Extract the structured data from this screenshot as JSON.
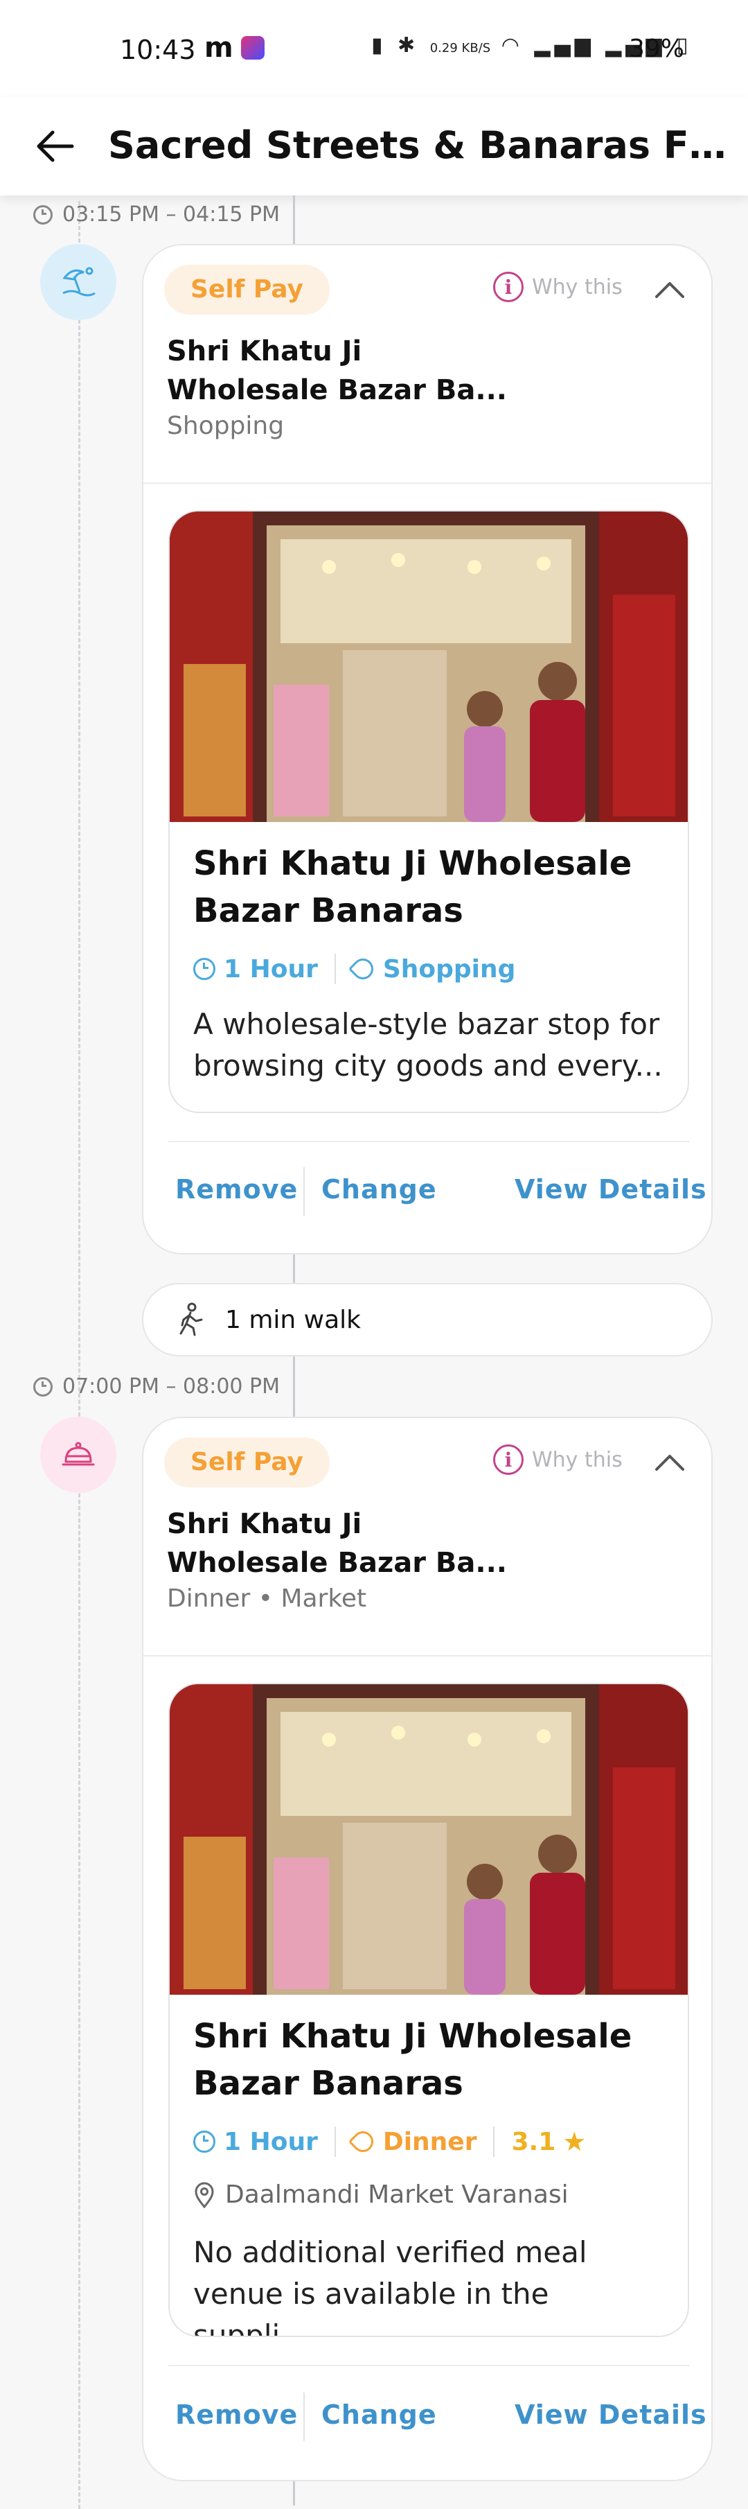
{
  "status_bar": {
    "time": "10:43",
    "app_letter": "m",
    "net_speed": "0.29 KB/S",
    "battery": "39%"
  },
  "header": {
    "title": "Sacred Streets & Banaras Flav..."
  },
  "activities": [
    {
      "time_range": "03:15 PM – 04:15 PM",
      "icon": "beach-umbrella-icon",
      "icon_bg": "#dbeffb",
      "icon_color": "#3ea6df",
      "badge": "Self Pay",
      "why_label": "Why this",
      "title_line1": "Shri Khatu Ji",
      "title_line2": "Wholesale Bazar Ba...",
      "subtitle": "Shopping",
      "detail": {
        "title_line1": "Shri Khatu Ji Wholesale",
        "title_line2": "Bazar Banaras",
        "duration": "1 Hour",
        "category": "Shopping",
        "description_line1": "A wholesale-style bazar stop for",
        "description_line2": "browsing city goods and every..."
      },
      "actions": {
        "remove": "Remove",
        "change": "Change",
        "view": "View Details"
      }
    },
    {
      "time_range": "07:00 PM – 08:00 PM",
      "icon": "dinner-cloche-icon",
      "icon_bg": "#fde6ef",
      "icon_color": "#d9417f",
      "badge": "Self Pay",
      "why_label": "Why this",
      "title_line1": "Shri Khatu Ji",
      "title_line2": "Wholesale Bazar Ba...",
      "subtitle": "Dinner • Market",
      "detail": {
        "title_line1": "Shri Khatu Ji Wholesale",
        "title_line2": "Bazar Banaras",
        "duration": "1 Hour",
        "category": "Dinner",
        "rating": "3.1",
        "location": "Daalmandi Market Varanasi",
        "description_line1": "No additional verified meal",
        "description_line2": "venue is available in the suppli..."
      },
      "actions": {
        "remove": "Remove",
        "change": "Change",
        "view": "View Details"
      }
    }
  ],
  "walk": {
    "label": "1 min walk"
  },
  "colors": {
    "accent_blue": "#3e92cc",
    "badge_orange": "#f5a034",
    "info_pink": "#c2448a"
  }
}
